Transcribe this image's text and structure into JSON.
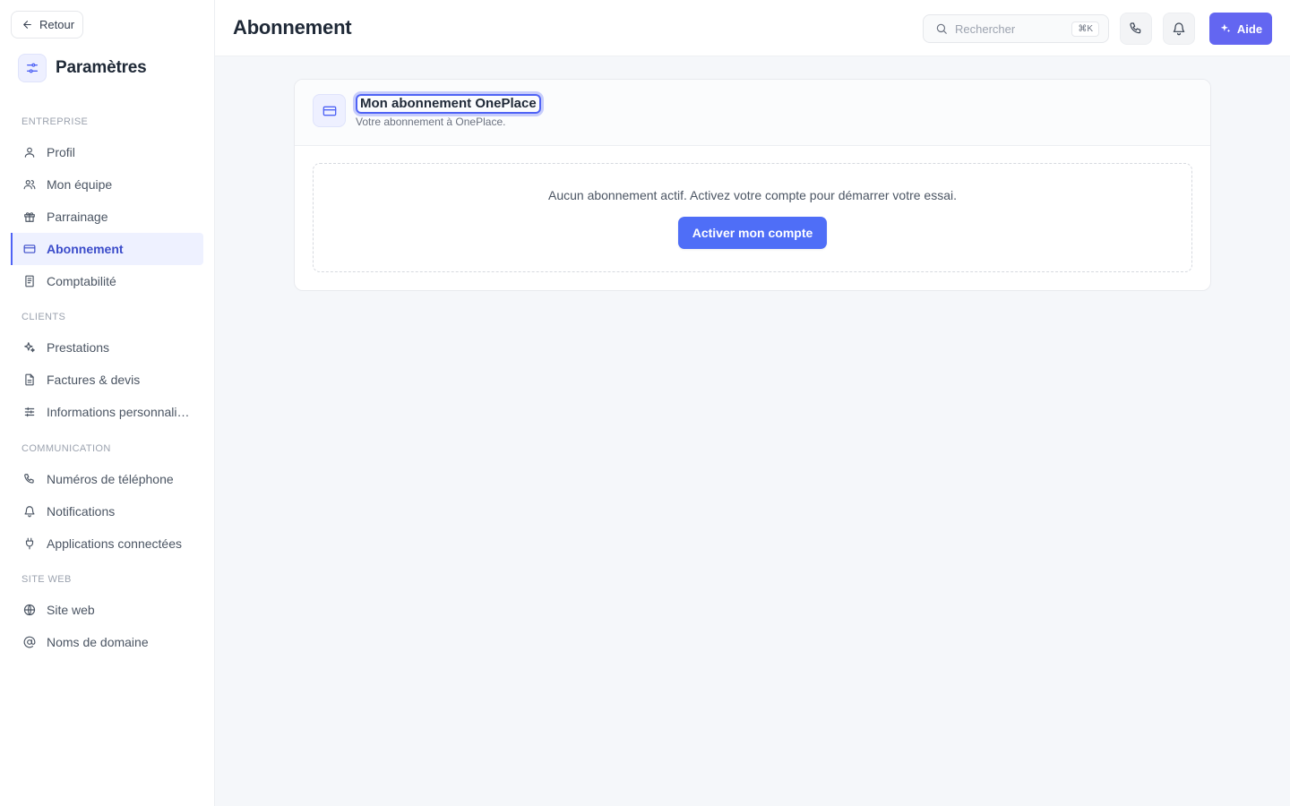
{
  "sidebar": {
    "back_label": "Retour",
    "title": "Paramètres",
    "sections": [
      {
        "heading": "ENTREPRISE",
        "items": [
          {
            "label": "Profil",
            "icon": "user-icon"
          },
          {
            "label": "Mon équipe",
            "icon": "users-icon"
          },
          {
            "label": "Parrainage",
            "icon": "gift-icon"
          },
          {
            "label": "Abonnement",
            "icon": "credit-card-icon",
            "active": true
          },
          {
            "label": "Comptabilité",
            "icon": "ledger-icon"
          }
        ]
      },
      {
        "heading": "CLIENTS",
        "items": [
          {
            "label": "Prestations",
            "icon": "sparkles-icon"
          },
          {
            "label": "Factures & devis",
            "icon": "document-icon"
          },
          {
            "label": "Informations personnalisées",
            "icon": "sliders-icon"
          }
        ]
      },
      {
        "heading": "COMMUNICATION",
        "items": [
          {
            "label": "Numéros de téléphone",
            "icon": "phone-icon"
          },
          {
            "label": "Notifications",
            "icon": "bell-icon"
          },
          {
            "label": "Applications connectées",
            "icon": "plug-icon"
          }
        ]
      },
      {
        "heading": "SITE WEB",
        "items": [
          {
            "label": "Site web",
            "icon": "globe-icon"
          },
          {
            "label": "Noms de domaine",
            "icon": "at-icon"
          }
        ]
      }
    ]
  },
  "header": {
    "title": "Abonnement",
    "search_placeholder": "Rechercher",
    "search_shortcut": "⌘K",
    "help_label": "Aide"
  },
  "card": {
    "title": "Mon abonnement OnePlace",
    "subtitle": "Votre abonnement à OnePlace.",
    "empty_text": "Aucun abonnement actif. Activez votre compte pour démarrer votre essai.",
    "activate_label": "Activer mon compte"
  },
  "colors": {
    "accent": "#4f6ef7",
    "help_button": "#6366f1",
    "active_nav_bg": "#eef1ff"
  }
}
